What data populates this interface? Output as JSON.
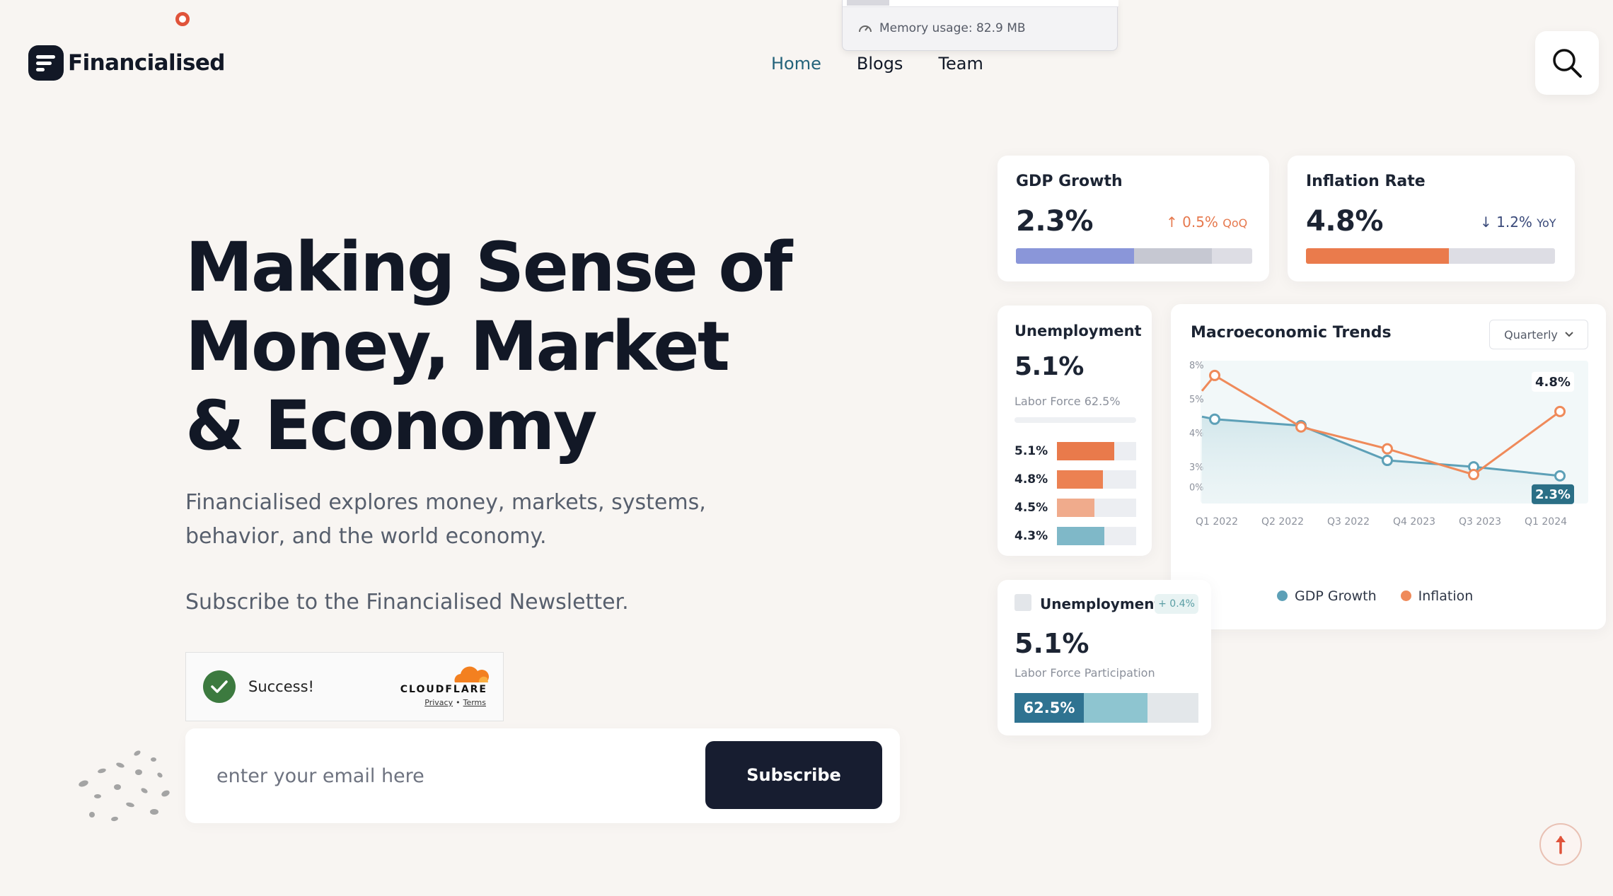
{
  "brand": {
    "name": "Financialised"
  },
  "nav": {
    "items": [
      "Home",
      "Blogs",
      "Team"
    ],
    "active": "Home"
  },
  "browser_overlay": {
    "memory_label": "Memory usage: 82.9 MB"
  },
  "hero": {
    "headline": "Making Sense of Money, Market & Economy",
    "description": "Financialised explores money, markets, systems, behavior, and the world economy.",
    "newsletter_label": "Subscribe to the Financialised Newsletter."
  },
  "captcha": {
    "status": "Success!",
    "provider": "CLOUDFLARE",
    "privacy": "Privacy",
    "separator": "•",
    "terms": "Terms"
  },
  "subscribe": {
    "placeholder": "enter your email here",
    "button": "Subscribe"
  },
  "cards": {
    "gdp": {
      "title": "GDP Growth",
      "value": "2.3%",
      "change": "0.5%",
      "period": "QoQ",
      "bar_fraction": 0.5,
      "bar_secondary_fraction": 0.83
    },
    "inflation": {
      "title": "Inflation Rate",
      "value": "4.8%",
      "change": "1.2%",
      "period": "YoY",
      "bar_fraction": 0.57
    },
    "unemployment": {
      "title": "Unemployment",
      "value": "5.1%",
      "subtitle": "Labor Force 62.5%",
      "bars": [
        {
          "label": "5.1%",
          "fraction": 0.72,
          "color": "#e97a4b"
        },
        {
          "label": "4.8%",
          "fraction": 0.58,
          "color": "#ec8152"
        },
        {
          "label": "4.5%",
          "fraction": 0.47,
          "color": "#f0ab8c"
        },
        {
          "label": "4.3%",
          "fraction": 0.6,
          "color": "#7fb8c8"
        }
      ]
    },
    "participation": {
      "title": "Unemployment",
      "badge": "+ 0.4%",
      "value": "5.1%",
      "subtitle": "Labor Force Participation",
      "bar_label": "62.5%",
      "bar_fraction": 0.38,
      "bar_secondary_fraction": 0.72
    }
  },
  "trends": {
    "title": "Macroeconomic Trends",
    "dropdown": "Quarterly",
    "legend": [
      "GDP Growth",
      "Inflation"
    ]
  },
  "chart_data": {
    "type": "line",
    "title": "Macroeconomic Trends",
    "x": [
      "Q1 2022",
      "Q2 2022",
      "Q3 2022",
      "Q4 2023",
      "Q3 2023",
      "Q1 2024"
    ],
    "y_ticks": [
      "8%",
      "5%",
      "4%",
      "3%",
      "0%"
    ],
    "series": [
      {
        "name": "GDP Growth",
        "color": "#5da0b7",
        "values": [
          4.5,
          4.25,
          2.9,
          2.65,
          2.3
        ],
        "end_label": "2.3%"
      },
      {
        "name": "Inflation",
        "color": "#ef8a5a",
        "values": [
          6.2,
          4.2,
          3.35,
          2.35,
          4.8
        ],
        "end_label": "4.8%"
      }
    ],
    "grid": false,
    "legend_position": "bottom"
  }
}
